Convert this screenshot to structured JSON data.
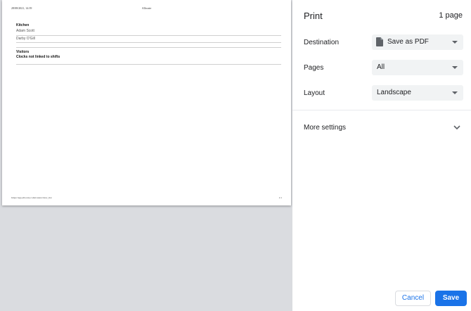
{
  "preview": {
    "header_date": "28/08/2021, 14:39",
    "header_title": "Allocate",
    "sections": [
      {
        "title": "Kitchen",
        "rows": [
          "Adam Scott",
          "Darby O'Gill"
        ]
      },
      {
        "title": "Visitors",
        "rows": []
      },
      {
        "title": "Clocks not linked to shifts",
        "rows": []
      }
    ],
    "footer_url": "https://app.allocate.com/rosters/view_list",
    "footer_page": "1/1"
  },
  "print": {
    "title": "Print",
    "page_count": "1 page",
    "destination_label": "Destination",
    "destination_value": "Save as PDF",
    "pages_label": "Pages",
    "pages_value": "All",
    "layout_label": "Layout",
    "layout_value": "Landscape",
    "more_settings": "More settings",
    "cancel": "Cancel",
    "save": "Save"
  },
  "colors": {
    "accent": "#1a73e8",
    "preview_background": "#dadce0",
    "select_background": "#f1f3f4"
  }
}
